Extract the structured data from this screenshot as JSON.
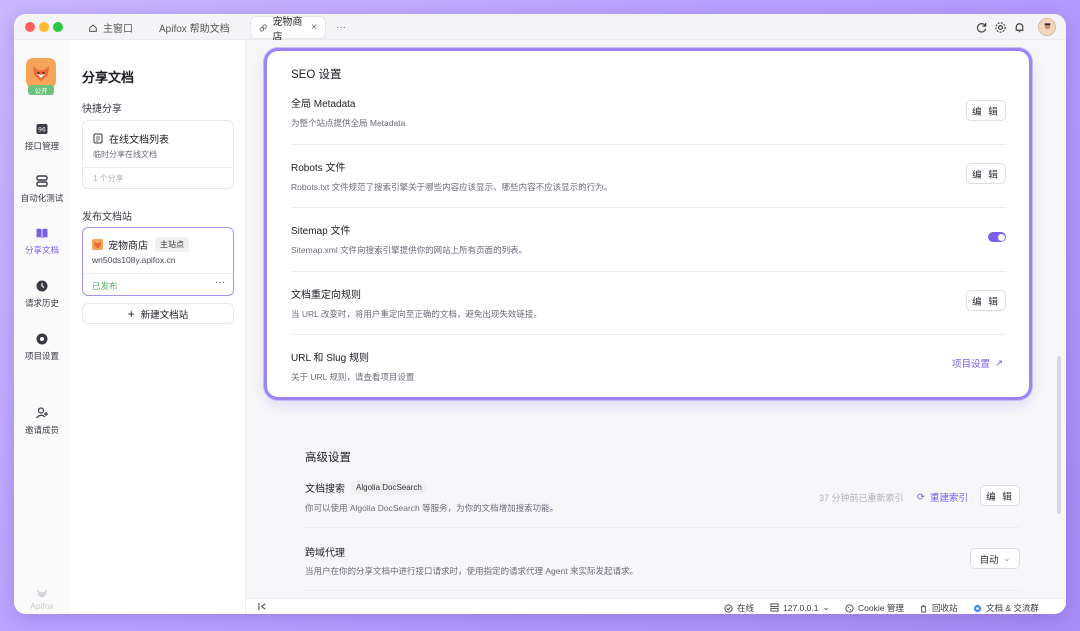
{
  "titlebar": {
    "tabs": [
      {
        "label": "主窗口"
      },
      {
        "label": "Apifox 帮助文档"
      },
      {
        "label": "宠物商店"
      }
    ],
    "more": "···"
  },
  "nav": {
    "project_badge": "公开",
    "items": [
      {
        "label": "接口管理"
      },
      {
        "label": "自动化测试"
      },
      {
        "label": "分享文档"
      },
      {
        "label": "请求历史"
      },
      {
        "label": "项目设置"
      },
      {
        "label": "邀请成员"
      }
    ],
    "brand": "Apifox"
  },
  "side": {
    "title": "分享文档",
    "quick_share": "快捷分享",
    "online_list_title": "在线文档列表",
    "online_list_desc": "临时分享在线文档",
    "online_list_count": "1 个分享",
    "publish_title": "发布文档站",
    "site_name": "宠物商店",
    "site_badge": "主站点",
    "site_domain": "wn50ds108y.apifox.cn",
    "site_status": "已发布",
    "site_more": "···",
    "new_site": "新建文档站"
  },
  "seo": {
    "title": "SEO 设置",
    "rows": [
      {
        "title": "全局 Metadata",
        "desc": "为整个站点提供全局 Metadata",
        "action": "编 辑"
      },
      {
        "title": "Robots 文件",
        "desc": "Robots.txt 文件规范了搜索引擎关于哪些内容应该显示、哪些内容不应该显示的行为。",
        "action": "编 辑"
      },
      {
        "title": "Sitemap 文件",
        "desc": "Sitemap.xml 文件向搜索引擎提供你的网站上所有页面的列表。",
        "toggle_on": true
      },
      {
        "title": "文档重定向规则",
        "desc": "当 URL 改变时，将用户重定向至正确的文档，避免出现失效链接。",
        "action": "编 辑"
      },
      {
        "title": "URL 和 Slug 规则",
        "desc": "关于 URL 规则，请查看项目设置",
        "link": "项目设置"
      }
    ]
  },
  "advanced": {
    "title": "高级设置",
    "search_title": "文档搜索",
    "search_badge": "Algolia DocSearch",
    "search_desc": "你可以使用 Algolia DocSearch 等服务，为你的文档增加搜索功能。",
    "search_meta": "37 分钟前已重新索引",
    "reindex": "重建索引",
    "search_action": "编 辑",
    "proxy_title": "跨域代理",
    "proxy_desc": "当用户在你的分享文档中进行接口请求时，使用指定的请求代理 Agent 来实际发起请求。",
    "proxy_value": "自动"
  },
  "statusbar": {
    "online": "在线",
    "host": "127.0.0.1",
    "cookie": "Cookie 管理",
    "trash": "回收站",
    "docs": "文档 & 交流群"
  },
  "colors": {
    "accent": "#7a5ee8",
    "highlight_border": "#9c84f2"
  }
}
